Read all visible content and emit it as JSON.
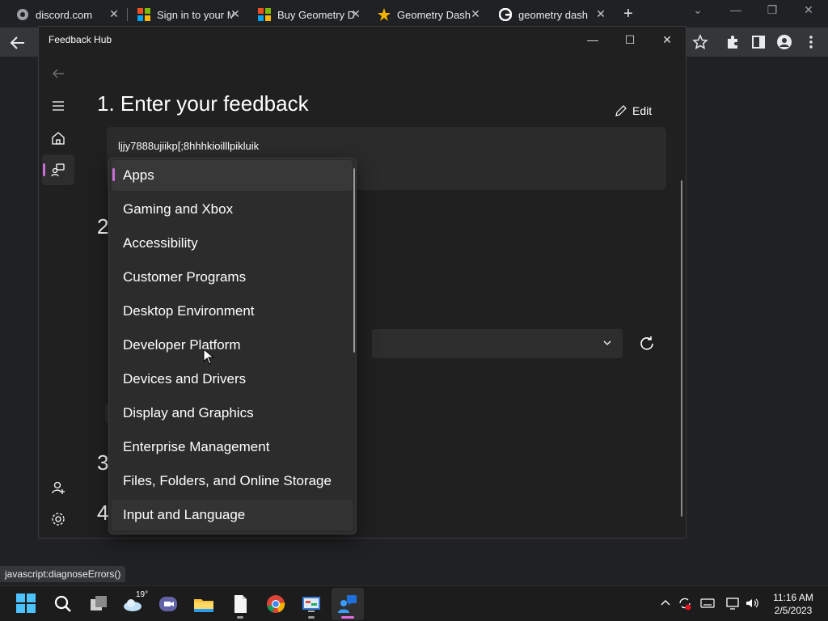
{
  "browser": {
    "tabs": [
      {
        "label": "discord.com",
        "icon": "discord-globe-icon"
      },
      {
        "label": "Sign in to your Microsoft",
        "icon": "microsoft-logo-icon"
      },
      {
        "label": "Buy Geometry Dash",
        "icon": "microsoft-store-icon"
      },
      {
        "label": "Geometry Dash",
        "icon": "star-icon"
      },
      {
        "label": "geometry dash",
        "icon": "google-g-icon"
      }
    ],
    "close_glyph": "✕",
    "new_tab_glyph": "+",
    "status_url": "javascript:diagnoseErrors()"
  },
  "feedback_hub": {
    "window_title": "Feedback Hub",
    "step1_title": "1. Enter your feedback",
    "edit_label": "Edit",
    "feedback_text": "ljjy7888ujiikp[;8hhhkioilllpikluik",
    "hidden_section_numbers": [
      "2",
      "3",
      "4"
    ],
    "category_options": [
      "Apps",
      "Gaming and Xbox",
      "Accessibility",
      "Customer Programs",
      "Desktop Environment",
      "Developer Platform",
      "Devices and Drivers",
      "Display and Graphics",
      "Enterprise Management",
      "Files, Folders, and Online Storage",
      "Input and Language"
    ],
    "selected_option": "Apps",
    "accent_color": "#c86ed6"
  },
  "taskbar": {
    "weather_temp": "19°",
    "clock_time": "11:16 AM",
    "clock_date": "2/5/2023"
  }
}
